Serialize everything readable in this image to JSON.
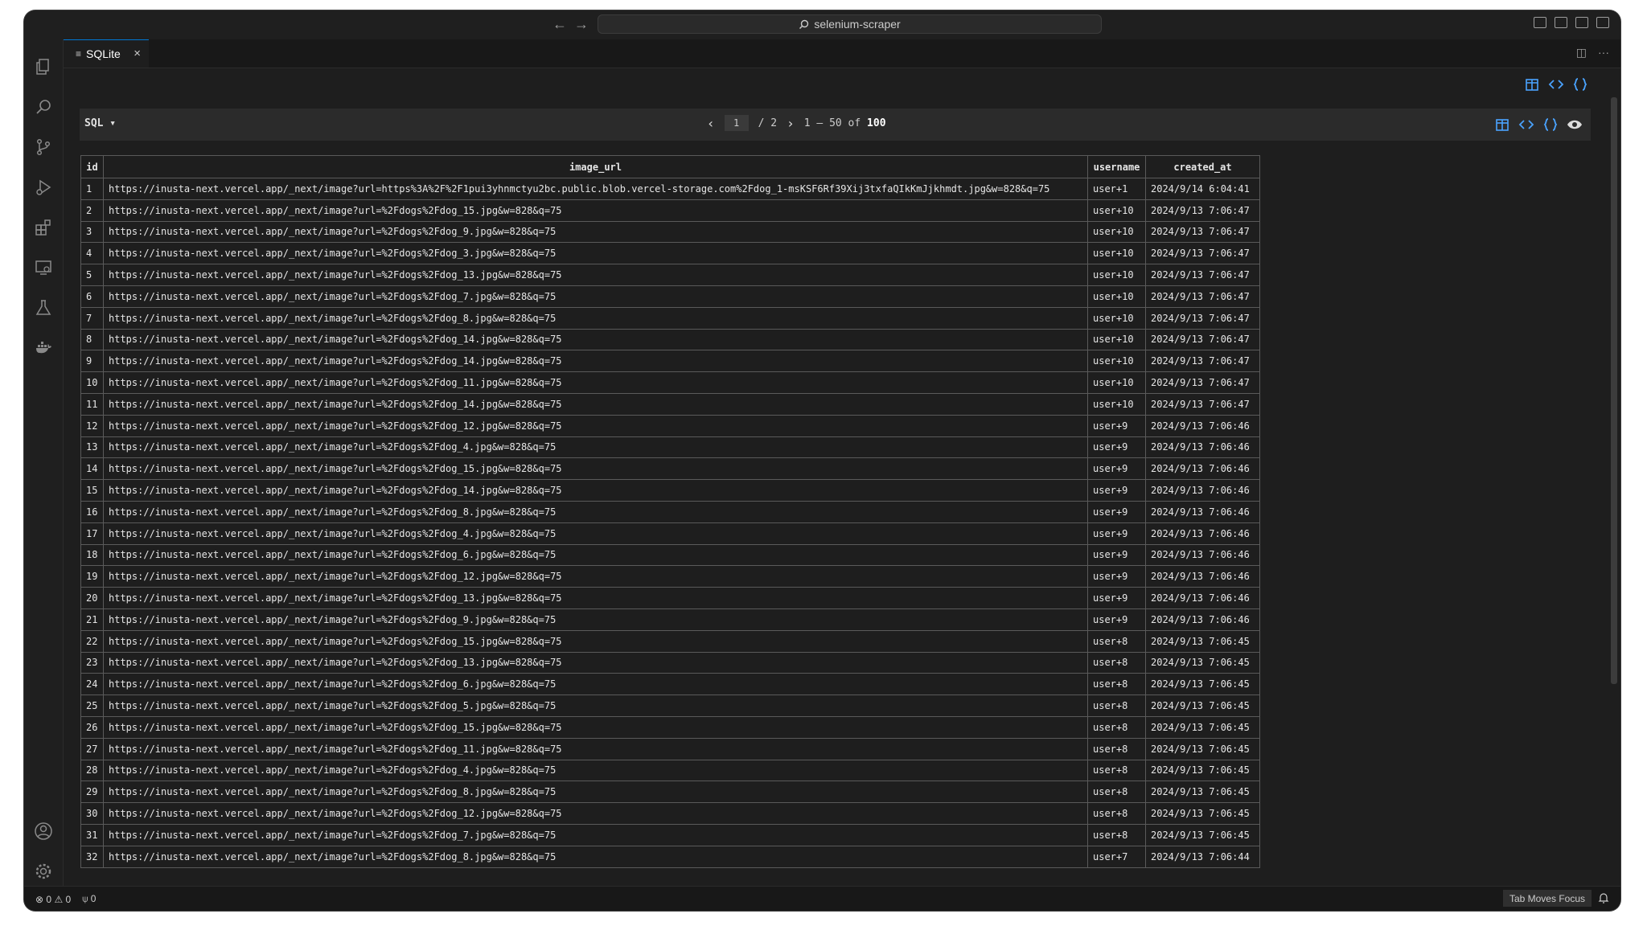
{
  "titlebar": {
    "back_icon": "arrow-left-icon",
    "forward_icon": "arrow-right-icon",
    "search_text": "selenium-scraper"
  },
  "tab": {
    "icon": "file-icon",
    "label": "SQLite",
    "close": "×"
  },
  "toolbar": {
    "sql_label": "SQL ▾",
    "page_current": "1",
    "page_total": "/ 2",
    "range_prefix": "1 – 50 of",
    "range_total": "100"
  },
  "table": {
    "columns": [
      "id",
      "image_url",
      "username",
      "created_at"
    ],
    "rows": [
      [
        "1",
        "https://inusta-next.vercel.app/_next/image?url=https%3A%2F%2F1pui3yhnmctyu2bc.public.blob.vercel-storage.com%2Fdog_1-msKSF6Rf39Xij3txfaQIkKmJjkhmdt.jpg&w=828&q=75",
        "user+1",
        "2024/9/14 6:04:41"
      ],
      [
        "2",
        "https://inusta-next.vercel.app/_next/image?url=%2Fdogs%2Fdog_15.jpg&w=828&q=75",
        "user+10",
        "2024/9/13 7:06:47"
      ],
      [
        "3",
        "https://inusta-next.vercel.app/_next/image?url=%2Fdogs%2Fdog_9.jpg&w=828&q=75",
        "user+10",
        "2024/9/13 7:06:47"
      ],
      [
        "4",
        "https://inusta-next.vercel.app/_next/image?url=%2Fdogs%2Fdog_3.jpg&w=828&q=75",
        "user+10",
        "2024/9/13 7:06:47"
      ],
      [
        "5",
        "https://inusta-next.vercel.app/_next/image?url=%2Fdogs%2Fdog_13.jpg&w=828&q=75",
        "user+10",
        "2024/9/13 7:06:47"
      ],
      [
        "6",
        "https://inusta-next.vercel.app/_next/image?url=%2Fdogs%2Fdog_7.jpg&w=828&q=75",
        "user+10",
        "2024/9/13 7:06:47"
      ],
      [
        "7",
        "https://inusta-next.vercel.app/_next/image?url=%2Fdogs%2Fdog_8.jpg&w=828&q=75",
        "user+10",
        "2024/9/13 7:06:47"
      ],
      [
        "8",
        "https://inusta-next.vercel.app/_next/image?url=%2Fdogs%2Fdog_14.jpg&w=828&q=75",
        "user+10",
        "2024/9/13 7:06:47"
      ],
      [
        "9",
        "https://inusta-next.vercel.app/_next/image?url=%2Fdogs%2Fdog_14.jpg&w=828&q=75",
        "user+10",
        "2024/9/13 7:06:47"
      ],
      [
        "10",
        "https://inusta-next.vercel.app/_next/image?url=%2Fdogs%2Fdog_11.jpg&w=828&q=75",
        "user+10",
        "2024/9/13 7:06:47"
      ],
      [
        "11",
        "https://inusta-next.vercel.app/_next/image?url=%2Fdogs%2Fdog_14.jpg&w=828&q=75",
        "user+10",
        "2024/9/13 7:06:47"
      ],
      [
        "12",
        "https://inusta-next.vercel.app/_next/image?url=%2Fdogs%2Fdog_12.jpg&w=828&q=75",
        "user+9",
        "2024/9/13 7:06:46"
      ],
      [
        "13",
        "https://inusta-next.vercel.app/_next/image?url=%2Fdogs%2Fdog_4.jpg&w=828&q=75",
        "user+9",
        "2024/9/13 7:06:46"
      ],
      [
        "14",
        "https://inusta-next.vercel.app/_next/image?url=%2Fdogs%2Fdog_15.jpg&w=828&q=75",
        "user+9",
        "2024/9/13 7:06:46"
      ],
      [
        "15",
        "https://inusta-next.vercel.app/_next/image?url=%2Fdogs%2Fdog_14.jpg&w=828&q=75",
        "user+9",
        "2024/9/13 7:06:46"
      ],
      [
        "16",
        "https://inusta-next.vercel.app/_next/image?url=%2Fdogs%2Fdog_8.jpg&w=828&q=75",
        "user+9",
        "2024/9/13 7:06:46"
      ],
      [
        "17",
        "https://inusta-next.vercel.app/_next/image?url=%2Fdogs%2Fdog_4.jpg&w=828&q=75",
        "user+9",
        "2024/9/13 7:06:46"
      ],
      [
        "18",
        "https://inusta-next.vercel.app/_next/image?url=%2Fdogs%2Fdog_6.jpg&w=828&q=75",
        "user+9",
        "2024/9/13 7:06:46"
      ],
      [
        "19",
        "https://inusta-next.vercel.app/_next/image?url=%2Fdogs%2Fdog_12.jpg&w=828&q=75",
        "user+9",
        "2024/9/13 7:06:46"
      ],
      [
        "20",
        "https://inusta-next.vercel.app/_next/image?url=%2Fdogs%2Fdog_13.jpg&w=828&q=75",
        "user+9",
        "2024/9/13 7:06:46"
      ],
      [
        "21",
        "https://inusta-next.vercel.app/_next/image?url=%2Fdogs%2Fdog_9.jpg&w=828&q=75",
        "user+9",
        "2024/9/13 7:06:46"
      ],
      [
        "22",
        "https://inusta-next.vercel.app/_next/image?url=%2Fdogs%2Fdog_15.jpg&w=828&q=75",
        "user+8",
        "2024/9/13 7:06:45"
      ],
      [
        "23",
        "https://inusta-next.vercel.app/_next/image?url=%2Fdogs%2Fdog_13.jpg&w=828&q=75",
        "user+8",
        "2024/9/13 7:06:45"
      ],
      [
        "24",
        "https://inusta-next.vercel.app/_next/image?url=%2Fdogs%2Fdog_6.jpg&w=828&q=75",
        "user+8",
        "2024/9/13 7:06:45"
      ],
      [
        "25",
        "https://inusta-next.vercel.app/_next/image?url=%2Fdogs%2Fdog_5.jpg&w=828&q=75",
        "user+8",
        "2024/9/13 7:06:45"
      ],
      [
        "26",
        "https://inusta-next.vercel.app/_next/image?url=%2Fdogs%2Fdog_15.jpg&w=828&q=75",
        "user+8",
        "2024/9/13 7:06:45"
      ],
      [
        "27",
        "https://inusta-next.vercel.app/_next/image?url=%2Fdogs%2Fdog_11.jpg&w=828&q=75",
        "user+8",
        "2024/9/13 7:06:45"
      ],
      [
        "28",
        "https://inusta-next.vercel.app/_next/image?url=%2Fdogs%2Fdog_4.jpg&w=828&q=75",
        "user+8",
        "2024/9/13 7:06:45"
      ],
      [
        "29",
        "https://inusta-next.vercel.app/_next/image?url=%2Fdogs%2Fdog_8.jpg&w=828&q=75",
        "user+8",
        "2024/9/13 7:06:45"
      ],
      [
        "30",
        "https://inusta-next.vercel.app/_next/image?url=%2Fdogs%2Fdog_12.jpg&w=828&q=75",
        "user+8",
        "2024/9/13 7:06:45"
      ],
      [
        "31",
        "https://inusta-next.vercel.app/_next/image?url=%2Fdogs%2Fdog_7.jpg&w=828&q=75",
        "user+8",
        "2024/9/13 7:06:45"
      ],
      [
        "32",
        "https://inusta-next.vercel.app/_next/image?url=%2Fdogs%2Fdog_8.jpg&w=828&q=75",
        "user+7",
        "2024/9/13 7:06:44"
      ]
    ]
  },
  "statusbar": {
    "errors": "0",
    "warnings": "0",
    "ports": "0",
    "tab_focus": "Tab Moves Focus"
  },
  "colors": {
    "accent": "#0078d4",
    "background": "#1e1e1e",
    "toolbar": "#2b2b2b",
    "icon_blue": "#4aa3ff"
  }
}
